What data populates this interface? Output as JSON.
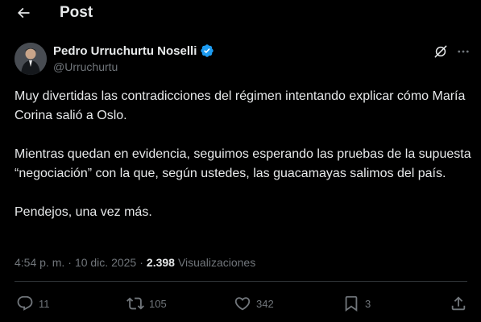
{
  "header": {
    "title": "Post"
  },
  "author": {
    "name": "Pedro Urruchurtu Noselli",
    "handle": "@Urruchurtu"
  },
  "tweet": {
    "paragraphs": [
      "Muy divertidas las contradicciones del régimen intentando explicar cómo María Corina salió a Oslo.",
      "Mientras quedan en evidencia, seguimos esperando las pruebas de la supuesta “negociación” con la que, según ustedes, las guacamayas salimos del país.",
      "Pendejos, una vez más."
    ]
  },
  "meta": {
    "time": "4:54 p. m.",
    "separator": "·",
    "date": "10 dic. 2025",
    "views_count": "2.398",
    "views_label": "Visualizaciones"
  },
  "actions": {
    "replies": "11",
    "reposts": "105",
    "likes": "342",
    "bookmarks": "3"
  },
  "colors": {
    "background": "#000000",
    "text_primary": "#e7e9ea",
    "text_secondary": "#71767b",
    "verified_blue": "#1d9bf0",
    "divider": "#2f3336"
  },
  "icons": {
    "back": "arrow-left-icon",
    "verified": "verified-badge-icon",
    "grok": "grok-icon",
    "more": "more-dots-icon",
    "reply": "reply-icon",
    "repost": "repost-icon",
    "like": "heart-icon",
    "bookmark": "bookmark-icon",
    "share": "share-icon"
  }
}
